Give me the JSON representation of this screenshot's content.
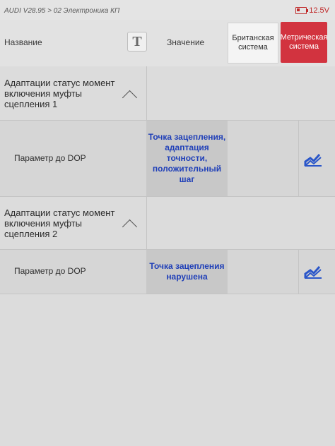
{
  "status_bar": {
    "breadcrumb": "AUDI V28.95 > 02 Электроника КП",
    "battery_voltage": "12.5V"
  },
  "header": {
    "name_column": "Название",
    "text_toggle_glyph": "T",
    "value_column": "Значение",
    "unit_british": "Британская система",
    "unit_metric": "Метрическая система",
    "unit_metric_selected": true
  },
  "rows": [
    {
      "group_title": "Адаптации статус момент включения муфты сцепления 1",
      "param_label": "Параметр до DOP",
      "value": "Точка зацепления, адаптация точности, положительный шаг"
    },
    {
      "group_title": "Адаптации статус момент включения муфты сцепления 2",
      "param_label": "Параметр до DOP",
      "value": "Точка зацепления нарушена"
    }
  ],
  "icons": {
    "collapse": "chevron-up-icon",
    "graph": "line-chart-icon",
    "battery": "battery-icon"
  },
  "colors": {
    "metric_active": "#d2333f",
    "value_text": "#1f3fb8",
    "graph_icon": "#2a56c9"
  }
}
